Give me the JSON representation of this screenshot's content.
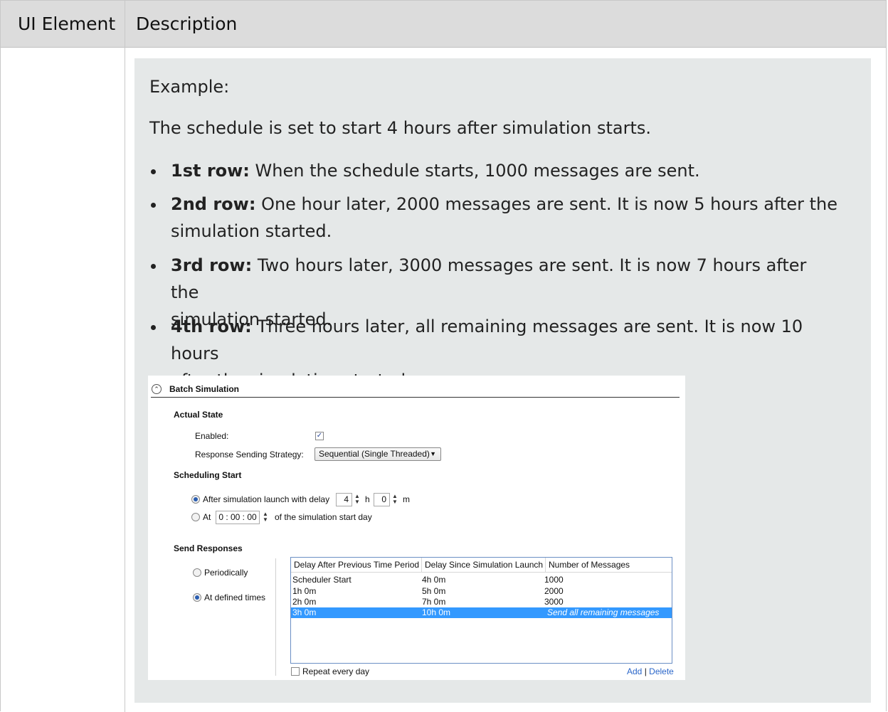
{
  "table": {
    "header_ui_element": "UI Element",
    "header_description": "Description"
  },
  "note": {
    "example_label": "Example:",
    "intro": "The schedule is set to start 4 hours after simulation starts.",
    "bullets": [
      {
        "label": "1st row:",
        "line1": "When the schedule starts, 1000 messages are sent.",
        "line2": ""
      },
      {
        "label": "2nd row:",
        "line1": "One hour later, 2000 messages are sent. It is now 5 hours after the",
        "line2": "simulation started."
      },
      {
        "label": "3rd row:",
        "line1": "Two hours later, 3000 messages are sent. It is now 7 hours after the",
        "line2": "simulation started."
      },
      {
        "label": "4th row:",
        "line1": "Three hours later, all remaining messages are sent. It is now 10 hours",
        "line2": "after the simulation started."
      }
    ]
  },
  "screenshot": {
    "section_title": "Batch Simulation",
    "actual_state": {
      "heading": "Actual State",
      "enabled_label": "Enabled:",
      "enabled_checked": true,
      "strategy_label": "Response Sending Strategy:",
      "strategy_value": "Sequential (Single Threaded)"
    },
    "scheduling": {
      "heading": "Scheduling Start",
      "option_delay_label": "After simulation launch with delay",
      "hours_value": "4",
      "hours_unit": "h",
      "minutes_value": "0",
      "minutes_unit": "m",
      "option_at_label": "At",
      "time_value": "0 : 00 : 00",
      "at_suffix": "of the simulation start day",
      "selected": "delay"
    },
    "send": {
      "heading": "Send Responses",
      "periodically_label": "Periodically",
      "defined_label": "At defined times",
      "selected": "defined",
      "columns": [
        "Delay After Previous Time Period",
        "Delay Since Simulation Launch",
        "Number of Messages"
      ],
      "rows": [
        [
          "Scheduler Start",
          "4h 0m",
          "1000"
        ],
        [
          "1h 0m",
          "5h 0m",
          "2000"
        ],
        [
          "2h 0m",
          "7h 0m",
          "3000"
        ],
        [
          "3h 0m",
          "10h 0m",
          "Send all remaining messages"
        ]
      ],
      "selected_row": 3,
      "repeat_label": "Repeat every day",
      "add_label": "Add",
      "separator": "|",
      "delete_label": "Delete"
    }
  }
}
